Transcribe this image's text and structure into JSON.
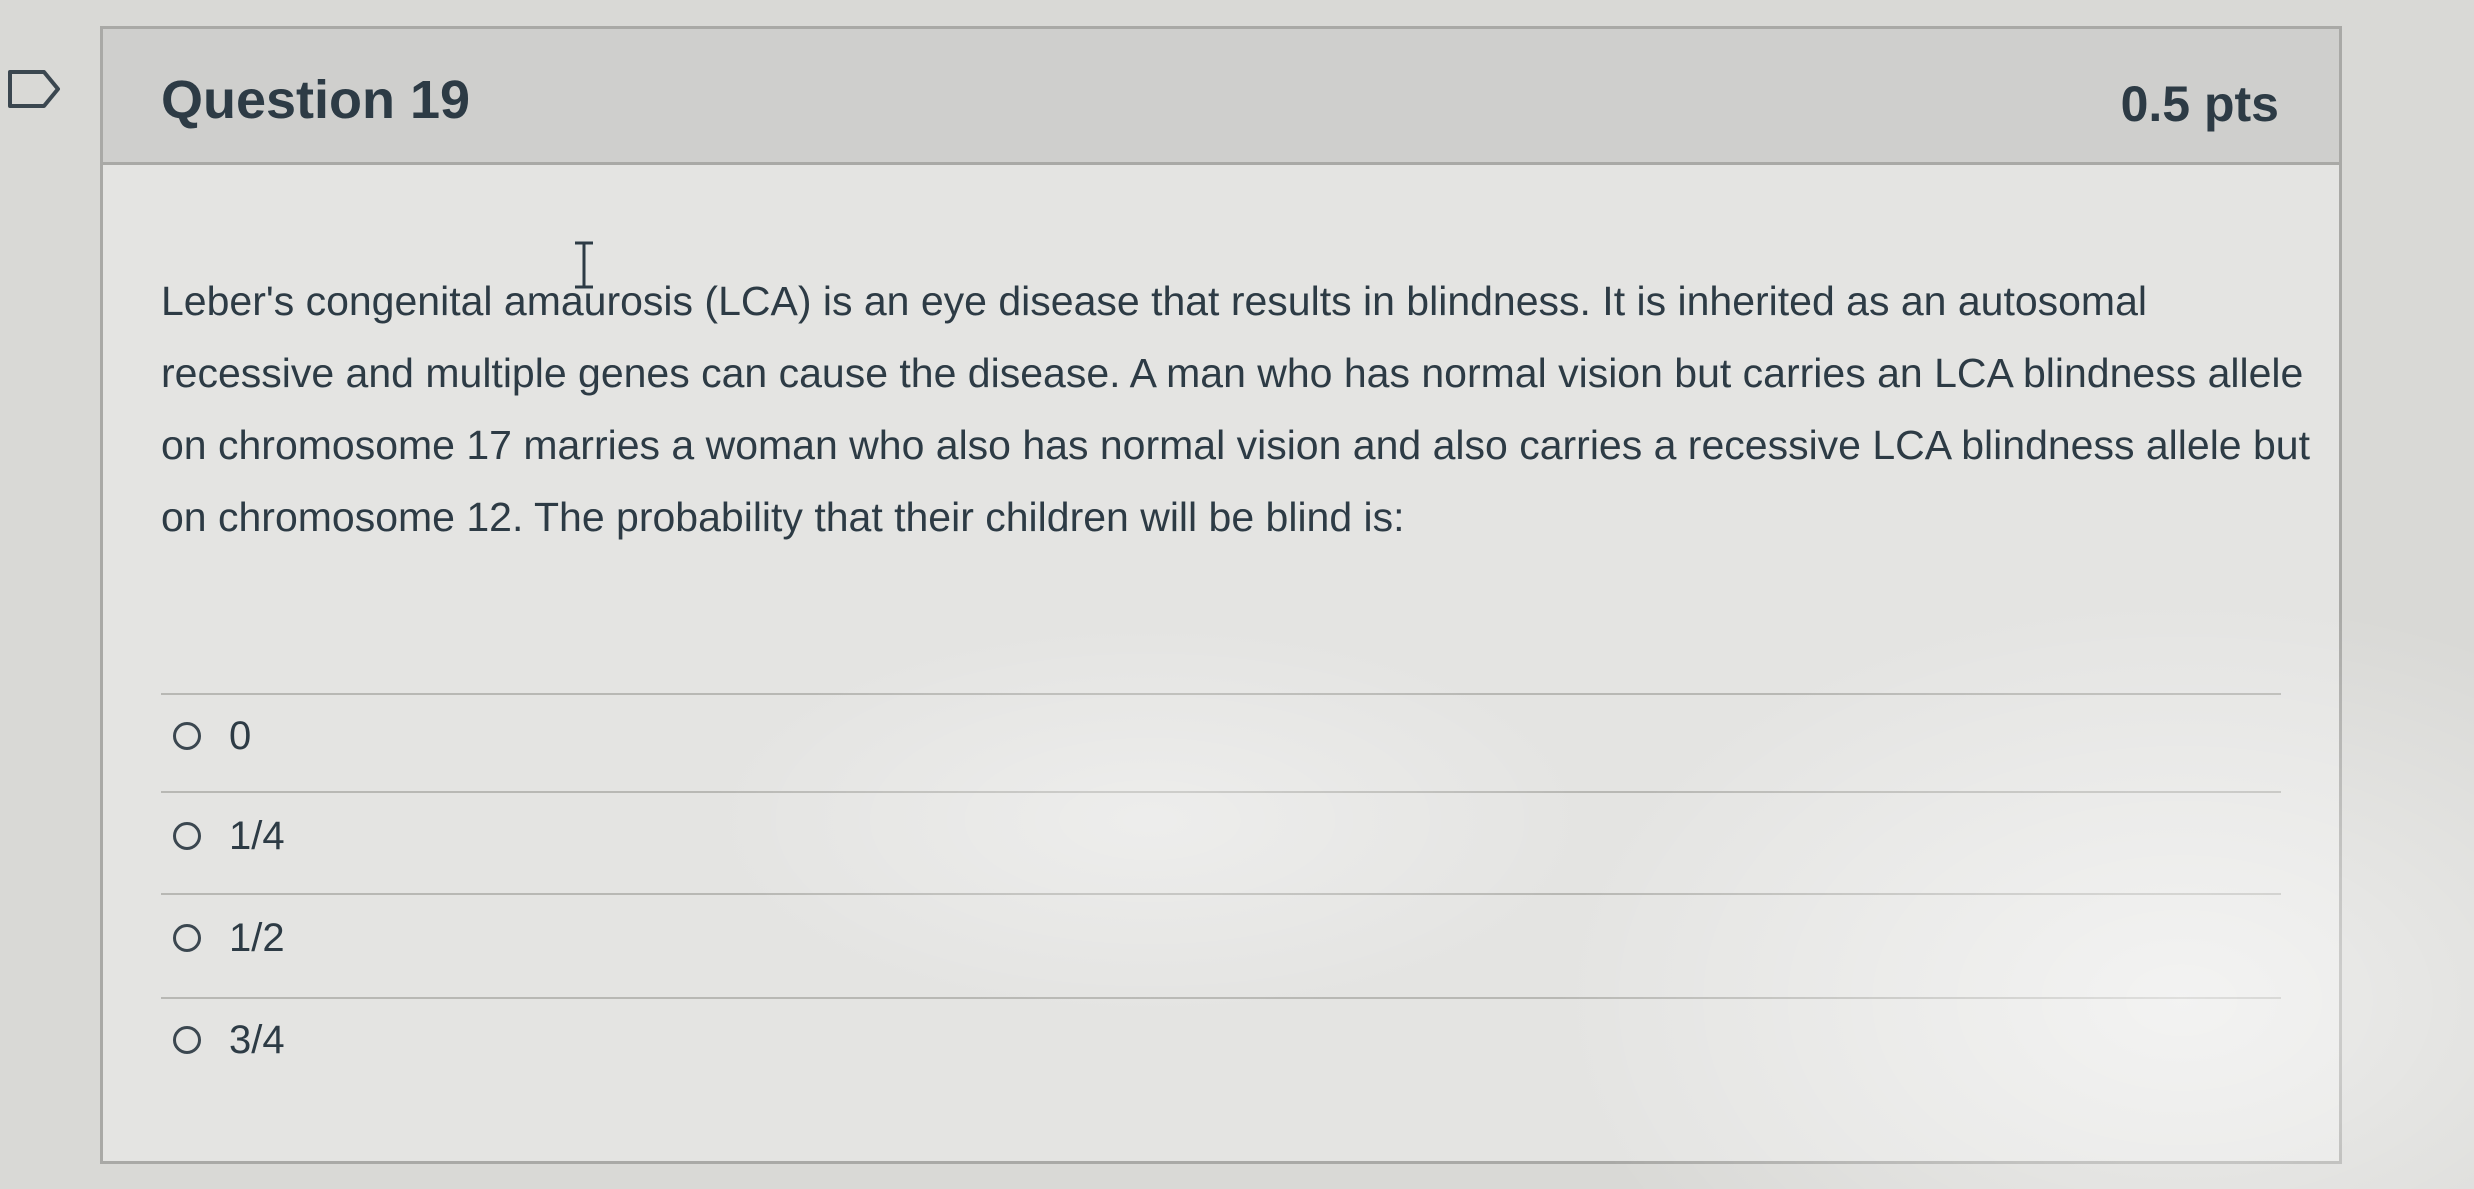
{
  "question": {
    "title": "Question 19",
    "points": "0.5 pts",
    "text": "Leber's congenital amaurosis (LCA) is an eye disease that results in blindness.  It is inherited as an autosomal recessive and multiple genes can cause the disease.  A man who has normal vision but carries an LCA blindness allele on chromosome 17 marries a woman who also has normal vision and also carries a recessive LCA blindness allele but on chromosome 12. The probability that their children will be blind is:"
  },
  "answers": [
    {
      "label": "0",
      "selected": false
    },
    {
      "label": "1/4",
      "selected": false
    },
    {
      "label": "1/2",
      "selected": false
    },
    {
      "label": "3/4",
      "selected": false
    }
  ],
  "icons": {
    "flag": "flag-outline-icon",
    "cursor": "text-cursor-icon"
  },
  "colors": {
    "text": "#2d3b45",
    "header_bg": "#cfcfcd",
    "card_bg": "#e4e4e2",
    "border": "#a9a9a6"
  }
}
